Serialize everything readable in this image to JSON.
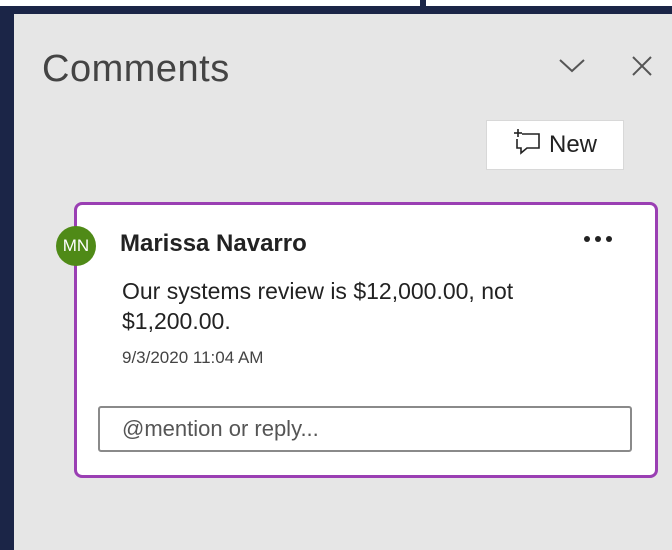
{
  "panel": {
    "title": "Comments",
    "icons": {
      "collapse": "chevron-down-icon",
      "close": "close-icon"
    }
  },
  "toolbar": {
    "new_label": "New",
    "new_icon": "new-comment-icon"
  },
  "comment": {
    "avatar_initials": "MN",
    "avatar_color": "#4f8a17",
    "author": "Marissa Navarro",
    "text": "Our systems review is $12,000.00, not $1,200.00.",
    "timestamp": "9/3/2020 11:04 AM",
    "more_icon": "more-options-icon",
    "reply_placeholder": "@mention or reply...",
    "accent_color": "#9a3fb3"
  }
}
